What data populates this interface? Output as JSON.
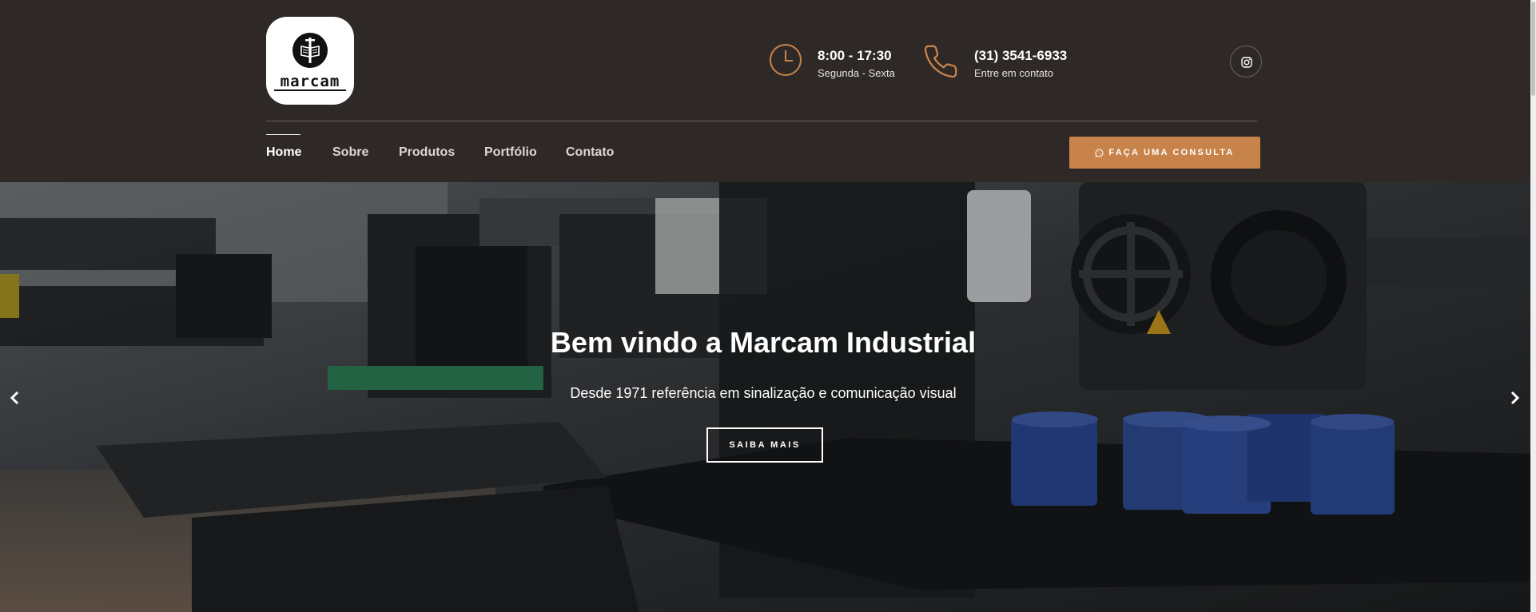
{
  "brand": {
    "logo_text": "marcam",
    "logo_icon": "book-emblem-icon"
  },
  "header": {
    "hours": {
      "icon": "clock-icon",
      "title": "8:00 - 17:30",
      "subtitle": "Segunda - Sexta"
    },
    "phone": {
      "icon": "phone-icon",
      "title": "(31) 3541-6933",
      "subtitle": "Entre em contato"
    },
    "social": {
      "icon": "instagram-icon"
    }
  },
  "nav": {
    "items": [
      {
        "label": "Home",
        "active": true
      },
      {
        "label": "Sobre",
        "active": false
      },
      {
        "label": "Produtos",
        "active": false
      },
      {
        "label": "Portfólio",
        "active": false
      },
      {
        "label": "Contato",
        "active": false
      }
    ],
    "cta": {
      "icon": "whatsapp-icon",
      "label": "FAÇA UMA CONSULTA"
    }
  },
  "hero": {
    "title": "Bem vindo a Marcam Industrial",
    "subtitle": "Desde 1971 referência em sinalização e comunicação visual",
    "button_label": "SAIBA MAIS",
    "prev_icon": "chevron-left-icon",
    "next_icon": "chevron-right-icon"
  },
  "colors": {
    "header_bg": "#2e2926",
    "accent": "#c8834a",
    "text_light": "#ffffff"
  }
}
